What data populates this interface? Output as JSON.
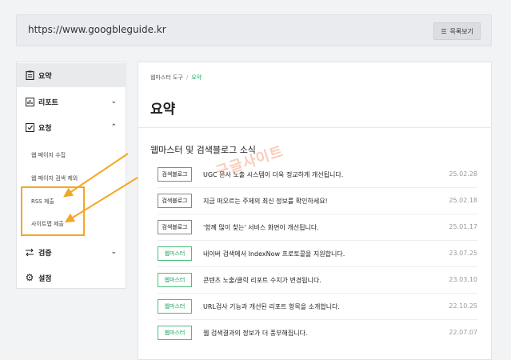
{
  "url_bar": {
    "url": "https://www.googbleguide.kr",
    "list_button_label": "목록보기"
  },
  "sidebar": {
    "items": [
      {
        "label": "요약"
      },
      {
        "label": "리포트"
      },
      {
        "label": "요청"
      },
      {
        "label": "검증"
      },
      {
        "label": "설정"
      }
    ],
    "sub_items": [
      {
        "label": "웹 페이지 수집"
      },
      {
        "label": "웹 페이지 검색 제외"
      },
      {
        "label": "RSS 제출"
      },
      {
        "label": "사이트맵 제출"
      }
    ]
  },
  "breadcrumb": {
    "parent": "웹마스터 도구",
    "current": "요약"
  },
  "main": {
    "title": "요약",
    "news_heading": "웹마스터 및 검색블로그 소식"
  },
  "news": [
    {
      "badge": "검색블로그",
      "type": "blog",
      "text": "UGC 문서 노출 시스템이 더욱 정교하게 개선됩니다.",
      "date": "25.02.28"
    },
    {
      "badge": "검색블로그",
      "type": "blog",
      "text": "지금 떠오르는 주제의 최신 정보를 확인하세요!",
      "date": "25.02.18"
    },
    {
      "badge": "검색블로그",
      "type": "blog",
      "text": "'함께 많이 찾는' 서비스 화면이 개선됩니다.",
      "date": "25.01.17"
    },
    {
      "badge": "웹마스터",
      "type": "webmaster",
      "text": "네이버 검색에서 IndexNow 프로토콜을 지원합니다.",
      "date": "23.07.25"
    },
    {
      "badge": "웹마스터",
      "type": "webmaster",
      "text": "콘텐츠 노출/클릭 리포트 수치가 변경됩니다.",
      "date": "23.03.10"
    },
    {
      "badge": "웹마스터",
      "type": "webmaster",
      "text": "URL검사 기능과 개선된 리포트 항목을 소개합니다.",
      "date": "22.10.25"
    },
    {
      "badge": "웹마스터",
      "type": "webmaster",
      "text": "웹 검색결과의 정보가 더 풍부해집니다.",
      "date": "22.07.07"
    }
  ],
  "watermark": "구글사이트",
  "colors": {
    "accent_green": "#1fb86c",
    "annotation_orange": "#f5a623"
  }
}
